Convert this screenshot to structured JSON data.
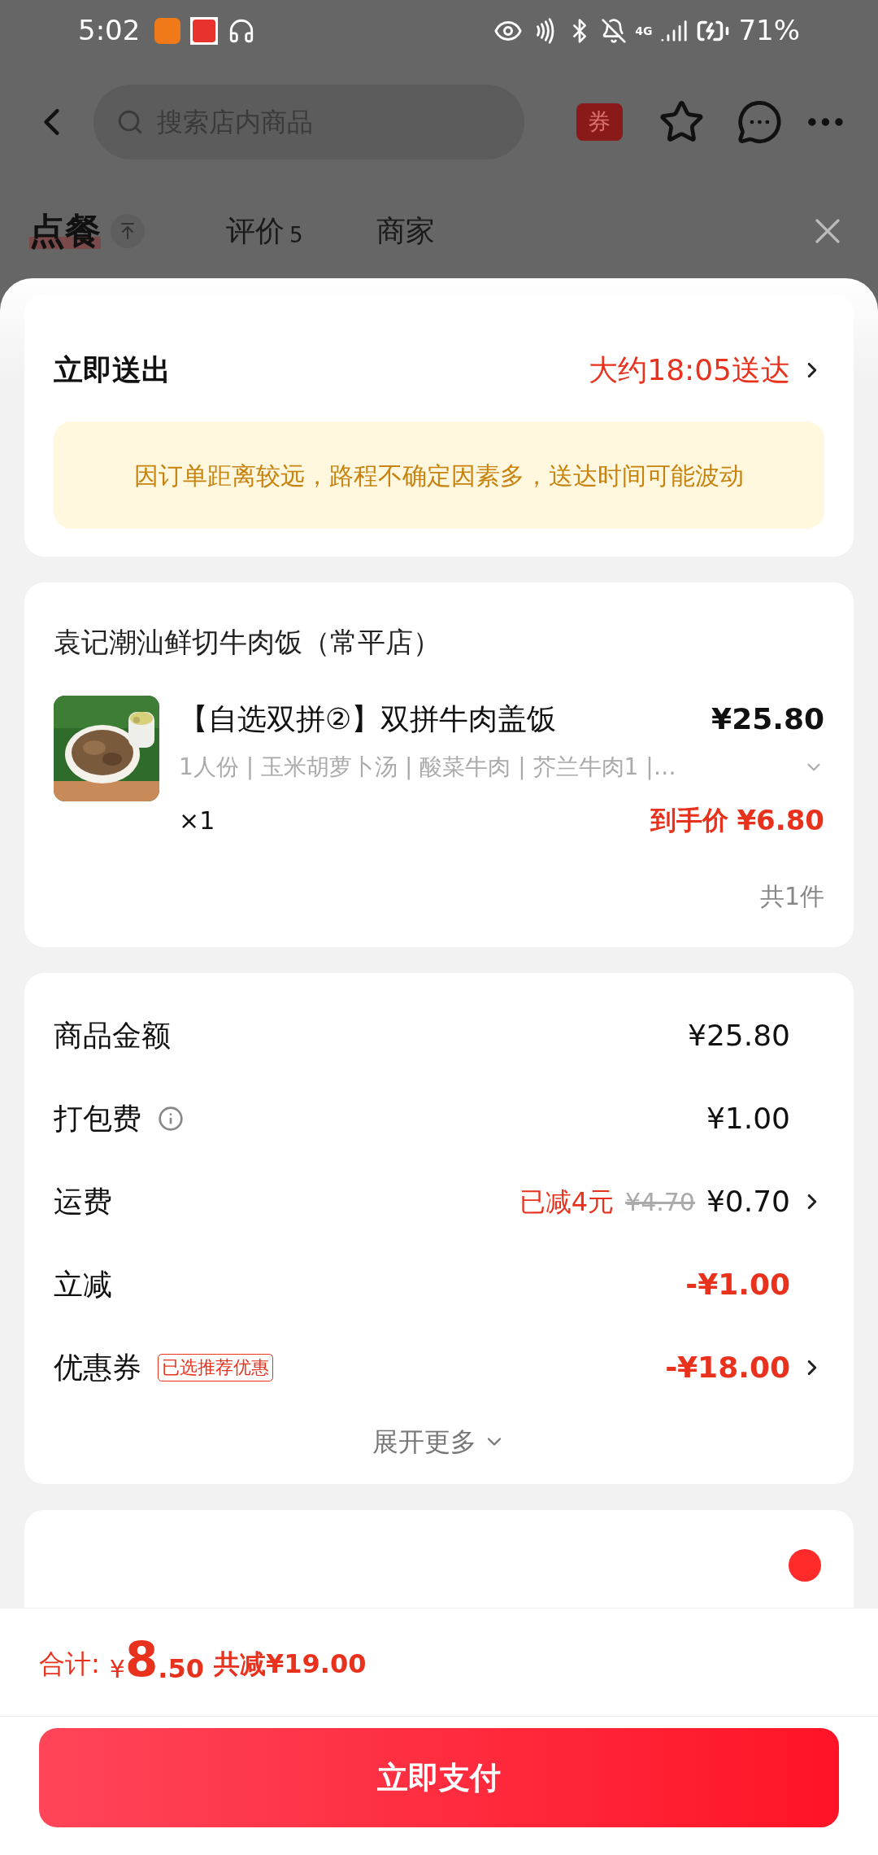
{
  "status_bar": {
    "time": "5:02",
    "network": "4G",
    "battery": "71%"
  },
  "header": {
    "search_placeholder": "搜索店内商品",
    "coupon_badge": "券"
  },
  "tabs": [
    {
      "label": "点餐",
      "selected": true
    },
    {
      "label": "评价",
      "count": "5",
      "selected": false
    },
    {
      "label": "商家",
      "selected": false
    }
  ],
  "delivery": {
    "title": "立即送出",
    "eta": "大约18:05送达",
    "notice": "因订单距离较远，路程不确定因素多，送达时间可能波动"
  },
  "store": {
    "name": "袁记潮汕鲜切牛肉饭（常平店）",
    "items": [
      {
        "title": "【自选双拼②】双拼牛肉盖饭",
        "price": "¥25.80",
        "specs": "1人份 | 玉米胡萝卜汤 | 酸菜牛肉 | 芥兰牛肉1 |…",
        "qty": "×1",
        "final_label": "到手价",
        "final_price": "¥6.80"
      }
    ],
    "total_count": "共1件"
  },
  "fees": [
    {
      "label": "商品金额",
      "value": "¥25.80",
      "discount": false,
      "info_icon": false,
      "chevron": false
    },
    {
      "label": "打包费",
      "value": "¥1.00",
      "discount": false,
      "info_icon": true,
      "chevron": false
    },
    {
      "label": "运费",
      "value": "¥0.70",
      "discount": false,
      "info_icon": false,
      "saved": "已减4元",
      "original": "¥4.70",
      "chevron": true
    },
    {
      "label": "立减",
      "value": "-¥1.00",
      "discount": true,
      "info_icon": false,
      "chevron": false
    },
    {
      "label": "优惠券",
      "value": "-¥18.00",
      "discount": true,
      "info_icon": false,
      "tag": "已选推荐优惠",
      "chevron": true
    }
  ],
  "expand": "展开更多",
  "footer": {
    "total_label": "合计:",
    "currency": "¥",
    "total_int": "8",
    "total_dec": ".50",
    "saved": "共减¥19.00",
    "pay_button": "立即支付"
  }
}
